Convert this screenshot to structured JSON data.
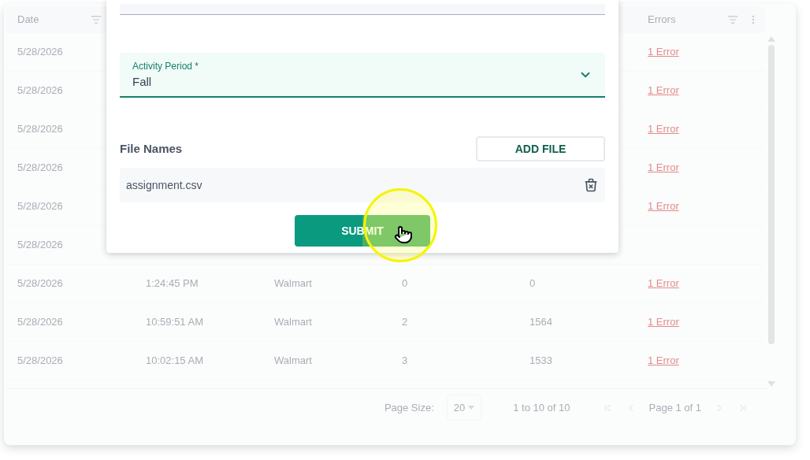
{
  "table": {
    "columns": [
      {
        "label": "Date",
        "filter": true,
        "menu": false
      },
      {
        "label": "Errors",
        "filter": true,
        "menu": true
      }
    ],
    "rows": [
      {
        "date": "5/28/2026",
        "errors": "1 Error"
      },
      {
        "date": "5/28/2026",
        "errors": "1 Error"
      },
      {
        "date": "5/28/2026",
        "errors": "1 Error"
      },
      {
        "date": "5/28/2026",
        "errors": "1 Error"
      },
      {
        "date": "5/28/2026",
        "errors": "1 Error"
      },
      {
        "date": "5/28/2026"
      },
      {
        "date": "5/28/2026",
        "column_2": "1:24:45 PM",
        "column_3": "Walmart",
        "column_4": "0",
        "column_5": "0",
        "errors": "1 Error"
      },
      {
        "date": "5/28/2026",
        "column_2": "10:59:51 AM",
        "column_3": "Walmart",
        "column_4": "2",
        "column_5": "1564",
        "errors": "1 Error"
      },
      {
        "date": "5/28/2026",
        "column_2": "10:02:15 AM",
        "column_3": "Walmart",
        "column_4": "3",
        "column_5": "1533",
        "errors": "1 Error"
      }
    ]
  },
  "pagination": {
    "page_size_label": "Page Size:",
    "page_size": "20",
    "range": "1 to 10 of 10",
    "page": "Page 1 of 1"
  },
  "dialog": {
    "activity_period": {
      "label": "Activity Period *",
      "value": "Fall"
    },
    "file_names_heading": "File Names",
    "add_file_button": "ADD FILE",
    "files": [
      {
        "name": "assignment.csv"
      }
    ],
    "submit_button": "SUBMIT"
  }
}
